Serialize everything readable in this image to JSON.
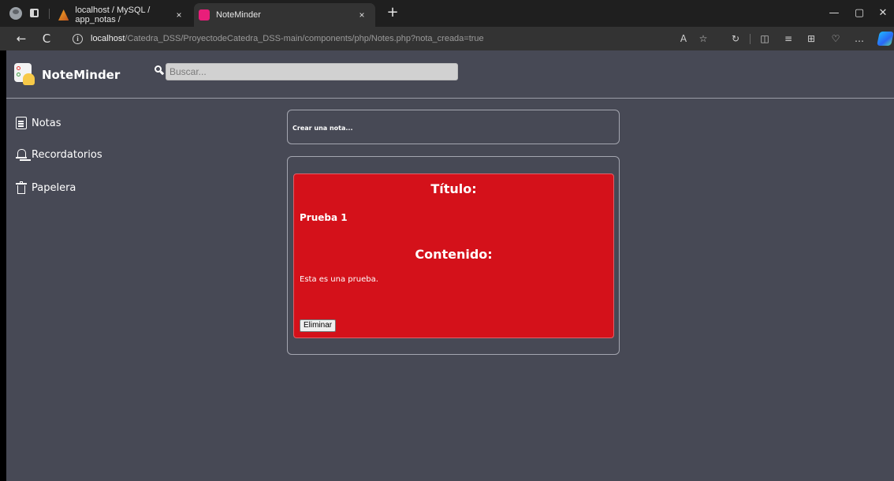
{
  "browser": {
    "tabs": [
      {
        "title": "localhost / MySQL / app_notas /",
        "favicon": "phpmyadmin-icon",
        "active": false
      },
      {
        "title": "NoteMinder",
        "favicon": "noteminder-favicon",
        "active": true
      }
    ],
    "tab_close": "×",
    "new_tab": "+",
    "url_host": "localhost",
    "url_path": "/Catedra_DSS/ProyectodeCatedra_DSS-main/components/php/Notes.php?nota_creada=true",
    "nav_back": "←",
    "nav_refresh": "C",
    "win_minimize": "—",
    "win_maximize": "▢",
    "win_close": "✕"
  },
  "header": {
    "brand": "NoteMinder",
    "search_placeholder": "Buscar..."
  },
  "sidebar": {
    "items": [
      {
        "label": "Notas",
        "icon": "document-icon"
      },
      {
        "label": "Recordatorios",
        "icon": "bell-icon"
      },
      {
        "label": "Papelera",
        "icon": "trash-icon"
      }
    ]
  },
  "main": {
    "create_prompt": "Crear una nota...",
    "notes": [
      {
        "title_label": "Título:",
        "title": "Prueba 1",
        "content_label": "Contenido:",
        "content": "Esta es una prueba.",
        "delete_label": "Eliminar",
        "color": "#d4111a"
      }
    ]
  },
  "colors": {
    "page_background": "#474955",
    "note_card": "#d4111a",
    "search_field": "#d1d1d1"
  }
}
